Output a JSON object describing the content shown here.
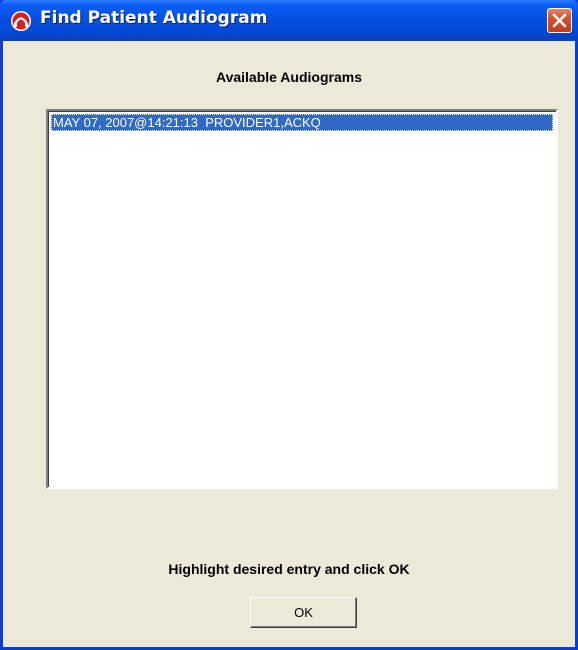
{
  "window": {
    "title": "Find Patient Audiogram"
  },
  "titlebar_icons": {
    "app_icon": "app-icon",
    "close_icon": "close-icon"
  },
  "dialog": {
    "heading": "Available Audiograms",
    "list_items": [
      {
        "label": "MAY 07, 2007@14:21:13  PROVIDER1,ACKQ",
        "selected": true
      }
    ],
    "instruction": "Highlight desired entry and click OK",
    "ok_label": "OK"
  },
  "colors": {
    "titlebar": "#0550e0",
    "selection": "#316ac5",
    "dialog_background": "#ece9d8",
    "close_button": "#d6502c"
  }
}
